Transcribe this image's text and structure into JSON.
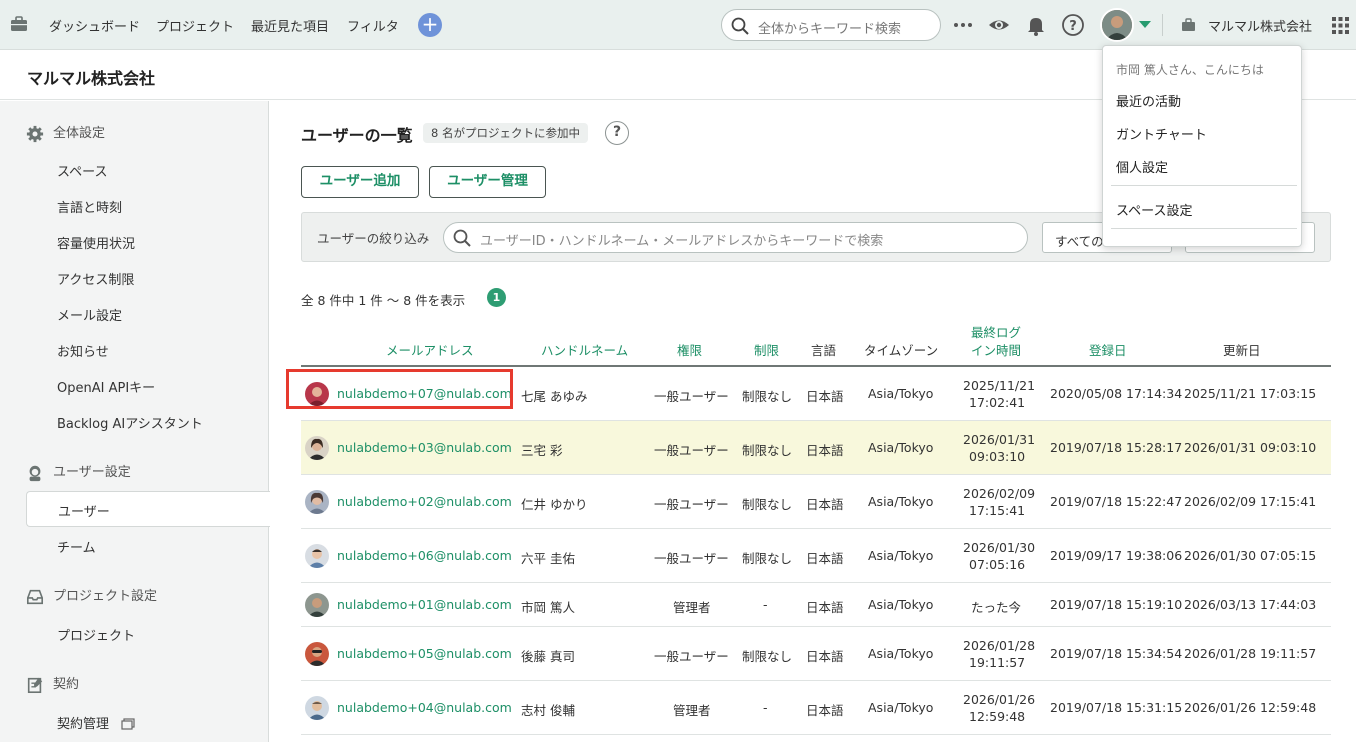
{
  "topbar": {
    "nav": [
      "ダッシュボード",
      "プロジェクト",
      "最近見た項目",
      "フィルタ"
    ],
    "search_placeholder": "全体からキーワード検索",
    "org_name": "マルマル株式会社",
    "icons": [
      "briefcase-icon",
      "plus-icon",
      "search-icon",
      "more-icon",
      "eye-icon",
      "bell-icon",
      "help-icon",
      "avatar",
      "apps-grid-icon"
    ]
  },
  "header": {
    "title": "マルマル株式会社"
  },
  "sidebar": {
    "sections": [
      {
        "label": "全体設定",
        "icon": "gear-icon",
        "items": [
          "スペース",
          "言語と時刻",
          "容量使用状況",
          "アクセス制限",
          "メール設定",
          "お知らせ",
          "OpenAI APIキー",
          "Backlog AIアシスタント"
        ]
      },
      {
        "label": "ユーザー設定",
        "icon": "user-icon",
        "items": [
          "ユーザー",
          "チーム"
        ]
      },
      {
        "label": "プロジェクト設定",
        "icon": "inbox-icon",
        "items": [
          "プロジェクト"
        ]
      },
      {
        "label": "契約",
        "icon": "contract-icon",
        "items": [
          "契約管理"
        ]
      }
    ],
    "active": "ユーザー"
  },
  "main": {
    "title": "ユーザーの一覧",
    "badge": "8 名がプロジェクトに参加中",
    "help": "?",
    "add_button": "ユーザー追加",
    "manage_button": "ユーザー管理",
    "filter_label": "ユーザーの絞り込み",
    "filter_placeholder": "ユーザーID・ハンドルネーム・メールアドレスからキーワードで検索",
    "filter_select": "すべての",
    "count_text": "全 8 件中 1 件 〜 8 件を表示",
    "page": "1"
  },
  "table": {
    "headers": [
      "メールアドレス",
      "ハンドルネーム",
      "権限",
      "制限",
      "言語",
      "タイムゾーン",
      "最終ログ",
      "イン時間",
      "登録日",
      "更新日"
    ],
    "rows": [
      {
        "email": "nulabdemo+07@nulab.com",
        "name": "七尾 あゆみ",
        "role": "一般ユーザー",
        "limit": "制限なし",
        "lang": "日本語",
        "tz": "Asia/Tokyo",
        "login1": "2025/11/21",
        "login2": "17:02:41",
        "registered": "2020/05/08 17:14:34",
        "updated": "2025/11/21 17:03:15"
      },
      {
        "email": "nulabdemo+03@nulab.com",
        "name": "三宅 彩",
        "role": "一般ユーザー",
        "limit": "制限なし",
        "lang": "日本語",
        "tz": "Asia/Tokyo",
        "login1": "2026/01/31",
        "login2": "09:03:10",
        "registered": "2019/07/18 15:28:17",
        "updated": "2026/01/31 09:03:10"
      },
      {
        "email": "nulabdemo+02@nulab.com",
        "name": "仁井 ゆかり",
        "role": "一般ユーザー",
        "limit": "制限なし",
        "lang": "日本語",
        "tz": "Asia/Tokyo",
        "login1": "2026/02/09",
        "login2": "17:15:41",
        "registered": "2019/07/18 15:22:47",
        "updated": "2026/02/09 17:15:41"
      },
      {
        "email": "nulabdemo+06@nulab.com",
        "name": "六平 圭佑",
        "role": "一般ユーザー",
        "limit": "制限なし",
        "lang": "日本語",
        "tz": "Asia/Tokyo",
        "login1": "2026/01/30",
        "login2": "07:05:16",
        "registered": "2019/09/17 19:38:06",
        "updated": "2026/01/30 07:05:15"
      },
      {
        "email": "nulabdemo+01@nulab.com",
        "name": "市岡 篤人",
        "role": "管理者",
        "limit": "-",
        "lang": "日本語",
        "tz": "Asia/Tokyo",
        "login1": "たった今",
        "login2": "",
        "registered": "2019/07/18 15:19:10",
        "updated": "2026/03/13 17:44:03"
      },
      {
        "email": "nulabdemo+05@nulab.com",
        "name": "後藤 真司",
        "role": "一般ユーザー",
        "limit": "制限なし",
        "lang": "日本語",
        "tz": "Asia/Tokyo",
        "login1": "2026/01/28",
        "login2": "19:11:57",
        "registered": "2019/07/18 15:34:54",
        "updated": "2026/01/28 19:11:57"
      },
      {
        "email": "nulabdemo+04@nulab.com",
        "name": "志村 俊輔",
        "role": "管理者",
        "limit": "-",
        "lang": "日本語",
        "tz": "Asia/Tokyo",
        "login1": "2026/01/26",
        "login2": "12:59:48",
        "registered": "2019/07/18 15:31:15",
        "updated": "2026/01/26 12:59:48"
      }
    ]
  },
  "dropdown": {
    "greeting": "市岡 篤人さん、こんにちは",
    "items": [
      "最近の活動",
      "ガントチャート",
      "個人設定",
      "スペース設定"
    ]
  },
  "colors": {
    "accent": "#1d8f66",
    "highlight_row": "#f8f8dc",
    "selection_box": "#e63a2e",
    "plus_button": "#6f93d9"
  }
}
